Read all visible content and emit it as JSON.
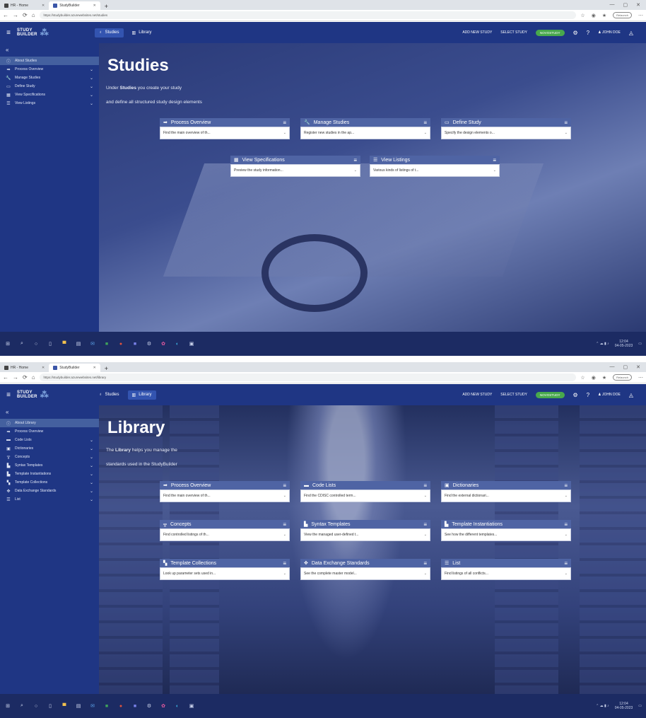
{
  "browser": {
    "tab1_title": "HR - Home",
    "tab2_title": "StudyBuilder",
    "new_tab": "+",
    "profile": "Relaunch",
    "shot1_url": "https://studybuilder.azurewebsites.net/studies",
    "shot2_url": "https://studybuilder.azurewebsites.net/library"
  },
  "header": {
    "logo_top": "STUDY",
    "logo_bottom": "BUILDER",
    "nav_studies": "Studies",
    "nav_library": "Library",
    "add_new_study": "ADD NEW STUDY",
    "select_study": "SELECT STUDY",
    "env_badge": "NOVOSTUDY",
    "user_name": "JOHN DOE"
  },
  "shot1": {
    "title": "Studies",
    "intro_line1_pre": "Under ",
    "intro_line1_bold": "Studies",
    "intro_line1_post": " you create your study",
    "intro_line2": "and define all structured study design elements",
    "sidebar": [
      {
        "label": "About Studies",
        "icon": "info-icon",
        "active": true
      },
      {
        "label": "Process Overview",
        "icon": "arrow-right-icon",
        "chevron": true
      },
      {
        "label": "Manage Studies",
        "icon": "wrench-icon",
        "chevron": true
      },
      {
        "label": "Define Study",
        "icon": "file-icon",
        "chevron": true
      },
      {
        "label": "View Specifications",
        "icon": "table-icon",
        "chevron": true
      },
      {
        "label": "View Listings",
        "icon": "list-icon",
        "chevron": true
      }
    ],
    "cards": [
      {
        "title": "Process Overview",
        "desc": "Find the main overview of th..."
      },
      {
        "title": "Manage Studies",
        "desc": "Register new studies in the ap..."
      },
      {
        "title": "Define Study",
        "desc": "Specify the design elements o..."
      },
      {
        "title": "View Specifications",
        "desc": "Preview the study information..."
      },
      {
        "title": "View Listings",
        "desc": "Various kinds of listings of t..."
      }
    ]
  },
  "shot2": {
    "title": "Library",
    "intro_line1_pre": "The ",
    "intro_line1_bold": "Library",
    "intro_line1_post": " helps you manage the",
    "intro_line2": "standards used in the StudyBuilder",
    "sidebar": [
      {
        "label": "About Library",
        "icon": "info-icon",
        "active": true
      },
      {
        "label": "Process Overview",
        "icon": "arrow-right-icon"
      },
      {
        "label": "Code Lists",
        "icon": "folder-icon",
        "chevron": true
      },
      {
        "label": "Dictionaries",
        "icon": "book-icon",
        "chevron": true
      },
      {
        "label": "Concepts",
        "icon": "hierarchy-icon",
        "chevron": true
      },
      {
        "label": "Syntax Templates",
        "icon": "template-icon",
        "chevron": true
      },
      {
        "label": "Template Instantiations",
        "icon": "template-icon",
        "chevron": true
      },
      {
        "label": "Template Collections",
        "icon": "collection-icon",
        "chevron": true
      },
      {
        "label": "Data Exchange Standards",
        "icon": "move-icon",
        "chevron": true
      },
      {
        "label": "List",
        "icon": "list-icon",
        "chevron": true
      }
    ],
    "cards": [
      {
        "title": "Process Overview",
        "desc": "Find the main overview of th..."
      },
      {
        "title": "Code Lists",
        "desc": "Find the CDISC controlled term..."
      },
      {
        "title": "Dictionaries",
        "desc": "Find the external dictionari..."
      },
      {
        "title": "Concepts",
        "desc": "Find controlled listings of th..."
      },
      {
        "title": "Syntax Templates",
        "desc": "View the managed user-defined t..."
      },
      {
        "title": "Template Instantiations",
        "desc": "See how the different templates..."
      },
      {
        "title": "Template Collections",
        "desc": "Look up parameter sets used in..."
      },
      {
        "title": "Data Exchange Standards",
        "desc": "See the complete master model..."
      },
      {
        "title": "List",
        "desc": "Find listings of all conflicts..."
      }
    ]
  },
  "taskbar": {
    "time": "12:04",
    "date": "04-05-2023"
  }
}
